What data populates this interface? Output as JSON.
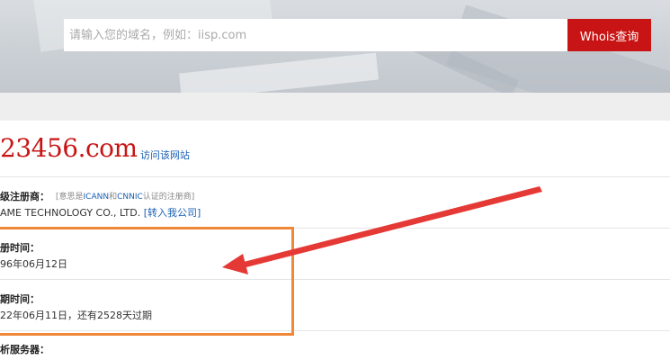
{
  "search": {
    "placeholder": "请输入您的域名，例如：iisp.com",
    "button_label": "Whois查询"
  },
  "domain": {
    "name": "23456.com",
    "visit_label": "访问该网站"
  },
  "registrar": {
    "label": "级注册商：",
    "note_prefix": "[意思是",
    "note_icann": "ICANN",
    "note_and": "和",
    "note_cnnic": "CNNIC",
    "note_suffix": "认证的注册商]",
    "value": "AME TECHNOLOGY CO., LTD.",
    "transfer_label": "[转入我公司]"
  },
  "created": {
    "label": "册时间：",
    "value": "96年06月12日"
  },
  "expire": {
    "label": "期时间：",
    "value": "22年06月11日，还有2528天过期"
  },
  "dns": {
    "label": "析服务器："
  },
  "colors": {
    "accent_red": "#c81414",
    "link_blue": "#1a5fb4",
    "highlight_orange": "#f0883a",
    "arrow_red": "#e53935"
  }
}
